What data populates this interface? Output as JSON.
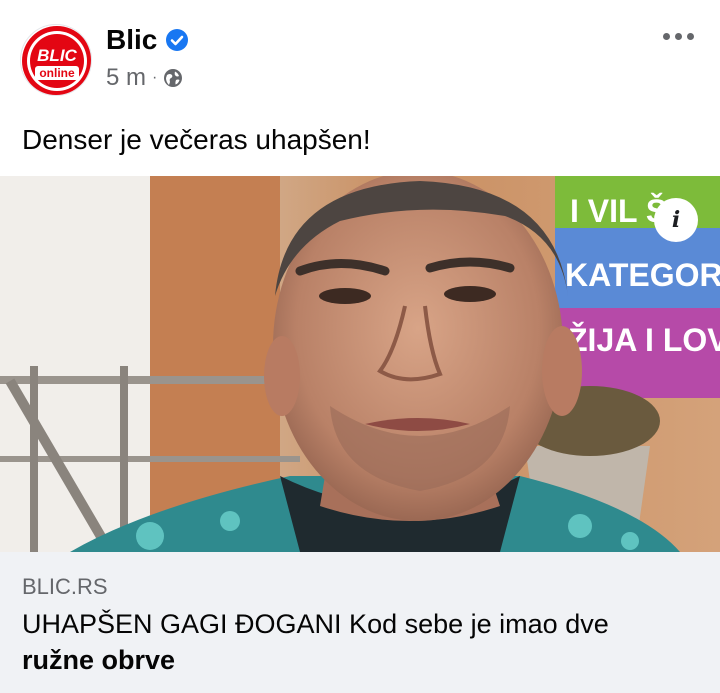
{
  "post": {
    "page_name": "Blic",
    "verified": true,
    "time": "5 m",
    "separator": "·",
    "audience_icon": "globe-icon",
    "more_icon": "more-options-icon",
    "text": "Denser je večeras uhapšen!",
    "avatar_logo": {
      "brand_text": "BLIC",
      "sub_text": "online",
      "color": "#e30613"
    }
  },
  "link_preview": {
    "info_label": "i",
    "domain": "BLIC.RS",
    "title_line1": "UHAPŠEN GAGI ĐOGANI Kod sebe je imao dve",
    "title_line2": "ružne obrve",
    "image_sign_lines": [
      "I VIL ŠI",
      "KATEGORI",
      "ŽIJA I LOV"
    ]
  },
  "colors": {
    "verified_blue": "#1877f2",
    "secondary_text": "#65676b",
    "footer_bg": "#f0f2f5"
  }
}
